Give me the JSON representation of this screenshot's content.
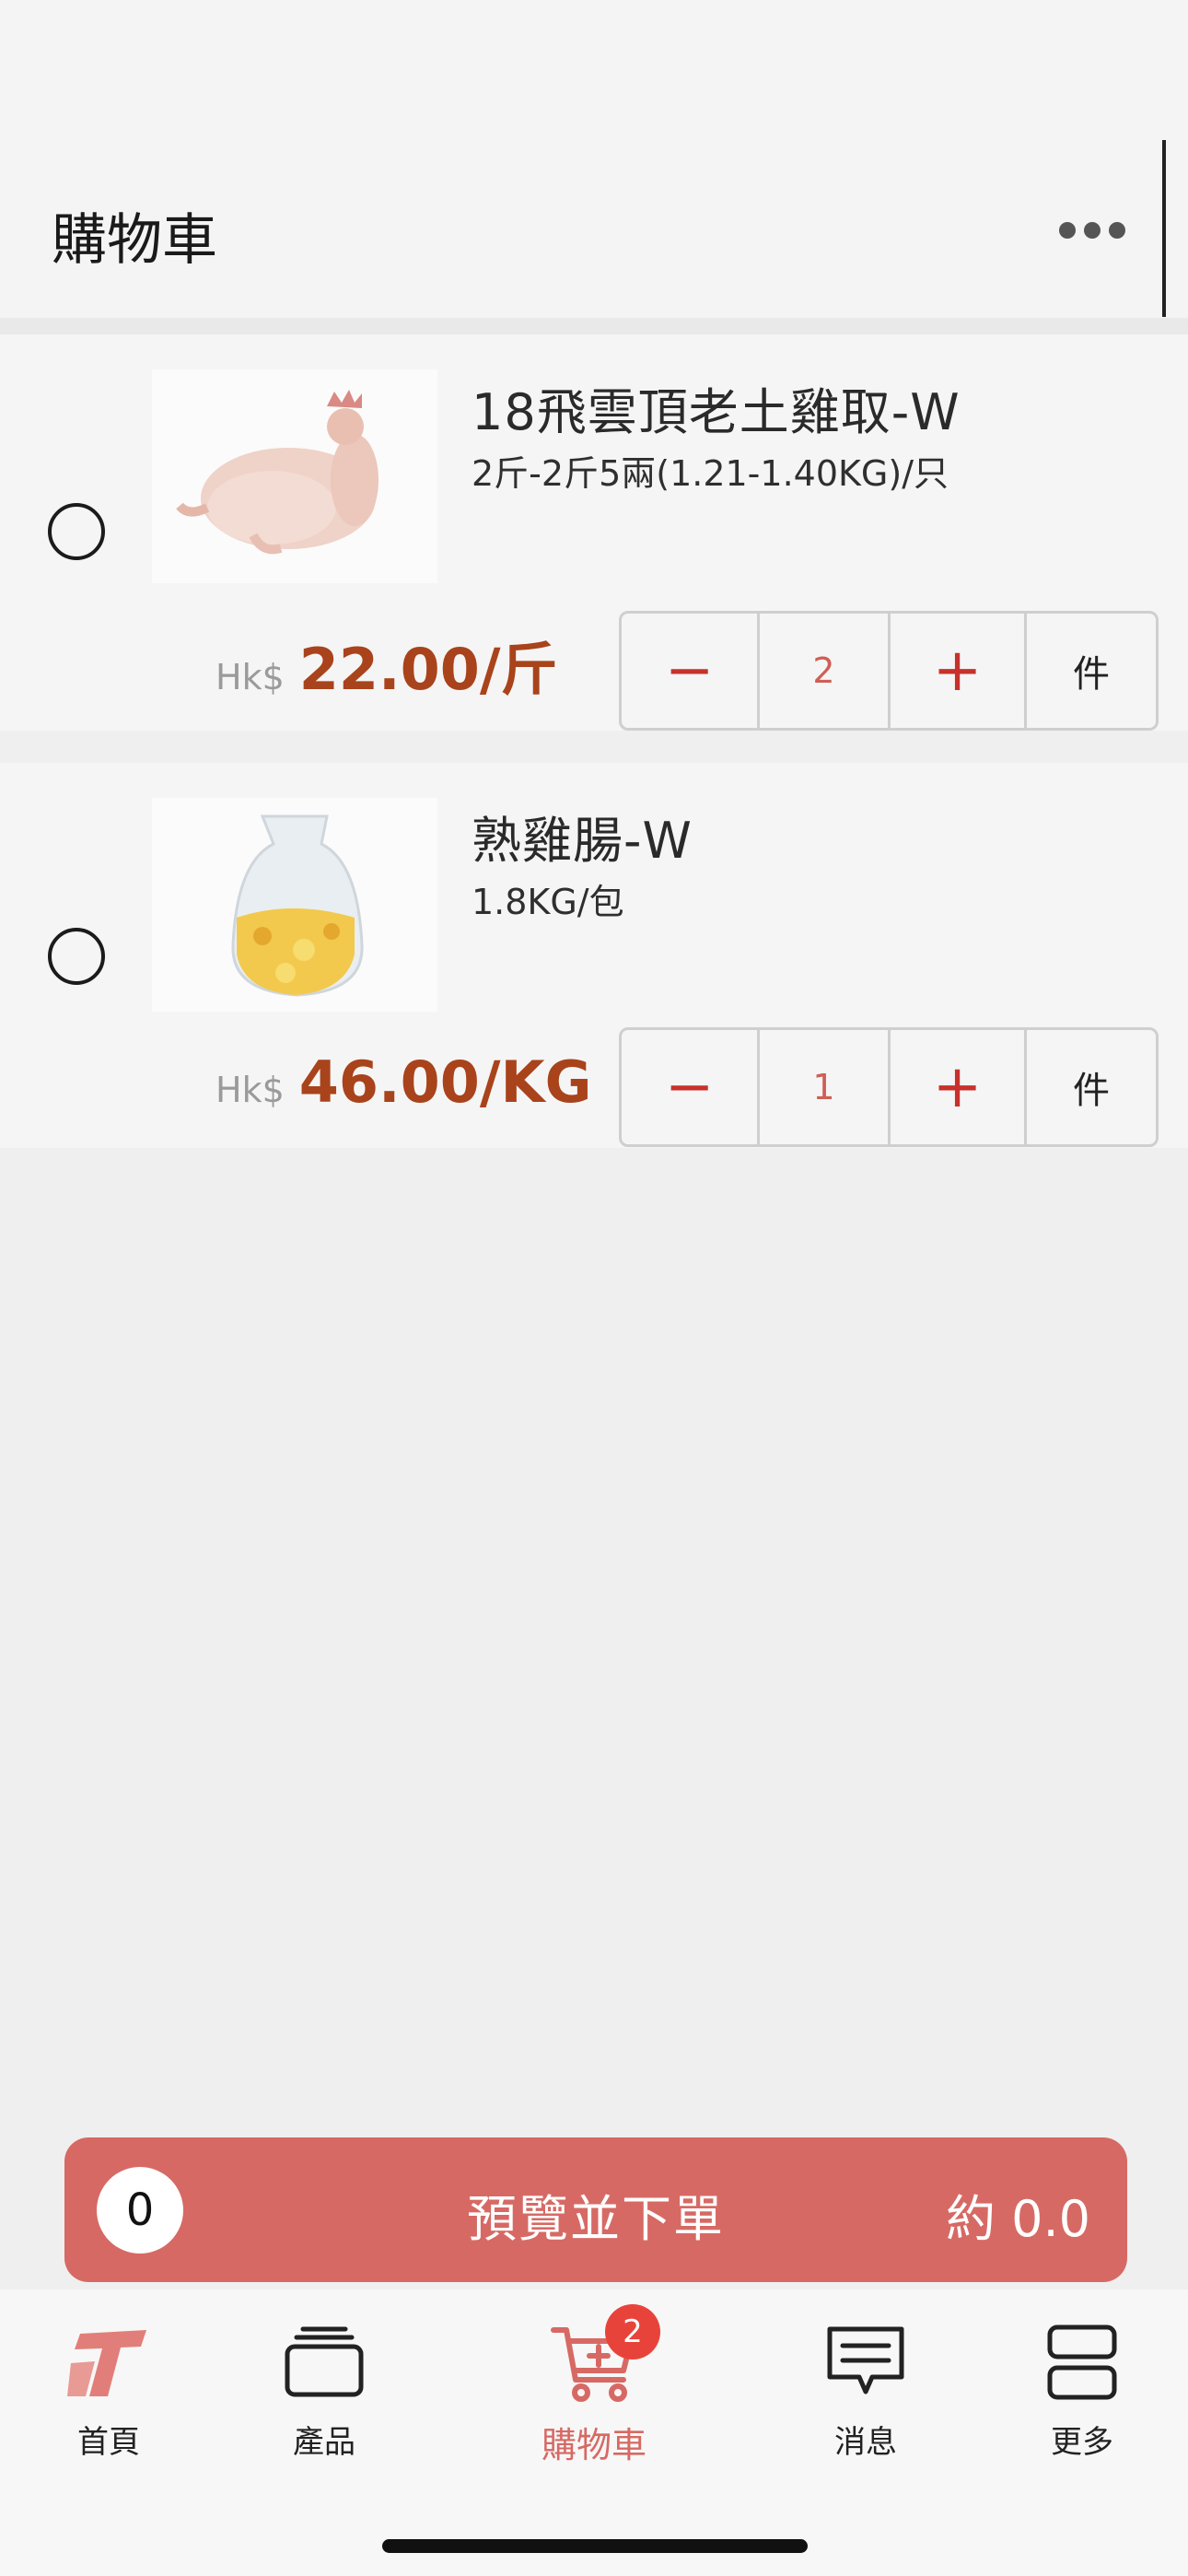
{
  "header": {
    "title": "購物車"
  },
  "cart": {
    "items": [
      {
        "name": "18飛雲頂老土雞取-W",
        "spec": "2斤-2斤5兩(1.21-1.40KG)/只",
        "currency": "Hk$",
        "price": "22.00/斤",
        "quantity": "2",
        "unit": "件",
        "image": "whole-chicken-image"
      },
      {
        "name": "熟雞腸-W",
        "spec": "1.8KG/包",
        "currency": "Hk$",
        "price": "46.00/KG",
        "quantity": "1",
        "unit": "件",
        "image": "chicken-intestine-bag-image"
      }
    ],
    "minus_symbol": "−",
    "plus_symbol": "+"
  },
  "checkout": {
    "selected_count": "0",
    "label": "預覽並下單",
    "total": "約 0.0",
    "color": "#d76964"
  },
  "tabbar": {
    "tabs": [
      {
        "label": "首頁",
        "icon": "home-logo-icon"
      },
      {
        "label": "產品",
        "icon": "products-icon"
      },
      {
        "label": "購物車",
        "icon": "cart-icon",
        "active": true,
        "badge": "2"
      },
      {
        "label": "消息",
        "icon": "message-icon"
      },
      {
        "label": "更多",
        "icon": "more-grid-icon"
      }
    ],
    "active_color": "#d76964"
  }
}
